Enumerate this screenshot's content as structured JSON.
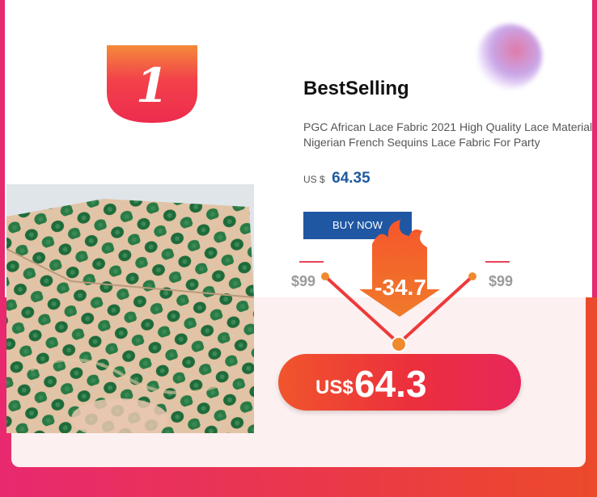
{
  "rank": {
    "number": "1"
  },
  "product": {
    "badge_title": "BestSelling",
    "description": "PGC African Lace Fabric 2021 High Quality Lace Material Nigerian French Sequins Lace Fabric For Party",
    "currency_label": "US $",
    "price": "64.35",
    "buy_label": "BUY NOW"
  },
  "promo": {
    "old_price_left": "$99",
    "old_price_right": "$99",
    "discount": "-34.7",
    "final_currency": "US$",
    "final_price": "64.3"
  },
  "colors": {
    "frame_pink": "#e52a6e",
    "button_blue": "#1f57a3",
    "price_blue": "#1e5aa0",
    "promo_red": "#ec2f3d",
    "promo_orange": "#f0552c"
  }
}
